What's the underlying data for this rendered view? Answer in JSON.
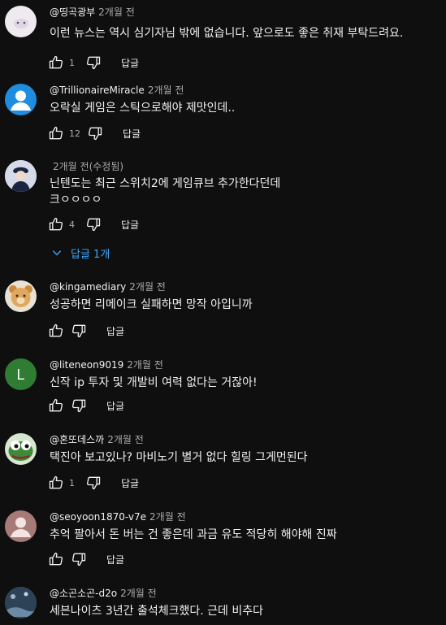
{
  "comments": [
    {
      "author": "@띵곡광부",
      "time": "2개월 전",
      "lines": [
        "이런 뉴스는 역시 심기자님 밖에 없습니다. 앞으로도 좋은 취재 부탁드려요."
      ],
      "likes": "1",
      "reply": "답글",
      "avatar_color": "#eeeaf0"
    },
    {
      "author": "@TrillionaireMiracle",
      "time": "2개월 전",
      "lines": [
        "오락실 게임은 스틱으로해야 제맛인데.."
      ],
      "likes": "12",
      "reply": "답글",
      "avatar_color": "#1f8ce0"
    },
    {
      "author": "",
      "time": "2개월 전(수정됨)",
      "lines": [
        "닌텐도는 최근 스위치2에 게임큐브 추가한다던데",
        "크ㅇㅇㅇㅇ"
      ],
      "likes": "4",
      "reply": "답글",
      "avatar_color": "#c9d1e2"
    },
    {
      "author": "@kingamediary",
      "time": "2개월 전",
      "lines": [
        "성공하면 리메이크 실패하면 망작 아입니까"
      ],
      "likes": "",
      "reply": "답글",
      "avatar_color": "#e2b06a"
    },
    {
      "author": "@liteneon9019",
      "time": "2개월 전",
      "lines": [
        "신작 ip 투자 및 개발비  여력 없다는 거잖아!"
      ],
      "likes": "",
      "reply": "답글",
      "avatar_color": "#2f7d32",
      "avatar_letter": "L"
    },
    {
      "author": "@혼또데스까",
      "time": "2개월 전",
      "lines": [
        "택진아 보고있나? 마비노기 별거 없다 힐링 그게먼된다"
      ],
      "likes": "1",
      "reply": "답글",
      "avatar_color": "#3f8a3a"
    },
    {
      "author": "@seoyoon1870-v7e",
      "time": "2개월 전",
      "lines": [
        "추억 팔아서 돈 버는 건 좋은데 과금 유도 적당히 해야해 진짜"
      ],
      "likes": "",
      "reply": "답글",
      "avatar_color": "#a67b77"
    },
    {
      "author": "@소곤소곤-d2o",
      "time": "2개월 전",
      "lines": [
        "세븐나이츠 3년간 출석체크했다.  근데 비추다"
      ],
      "likes": "",
      "reply": "답글",
      "avatar_color": "#3b5670"
    }
  ],
  "replies_toggle": "답글 1개"
}
